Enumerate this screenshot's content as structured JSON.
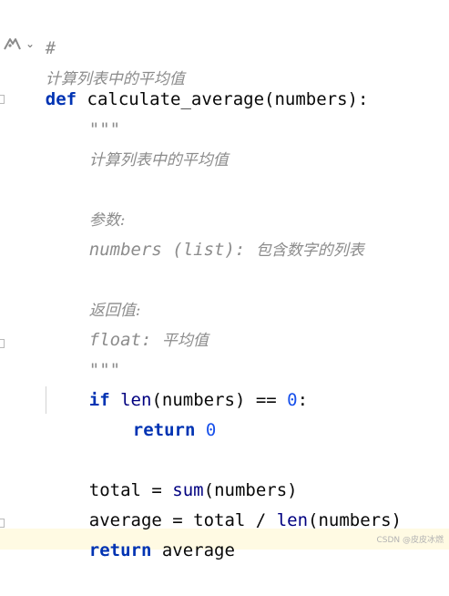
{
  "editor": {
    "comment_hash": "#",
    "comment_text": "计算列表中的平均值",
    "def_keyword": "def",
    "func_signature": "calculate_average(numbers):",
    "doc_open": "\"\"\"",
    "doc_summary": "计算列表中的平均值",
    "doc_params_header": "参数:",
    "doc_param_name": "numbers (list):",
    "doc_param_desc": "包含数字的列表",
    "doc_returns_header": "返回值:",
    "doc_return_type": "float:",
    "doc_return_desc": "平均值",
    "doc_close": "\"\"\"",
    "if_keyword": "if",
    "len_builtin": "len",
    "if_args": "(numbers) ==",
    "zero_value": "0",
    "colon": ":",
    "return_keyword": "return",
    "return_zero": "0",
    "total_assign": "total =",
    "sum_builtin": "sum",
    "sum_args": "(numbers)",
    "average_assign": "average = total /",
    "len_builtin_2": "len",
    "len_args_2": "(numbers)",
    "return_keyword_2": "return",
    "return_var": "average"
  },
  "watermark": "CSDN @皮皮冰燃",
  "icons": [
    "ai-assistant-icon",
    "chevron-down-icon"
  ]
}
